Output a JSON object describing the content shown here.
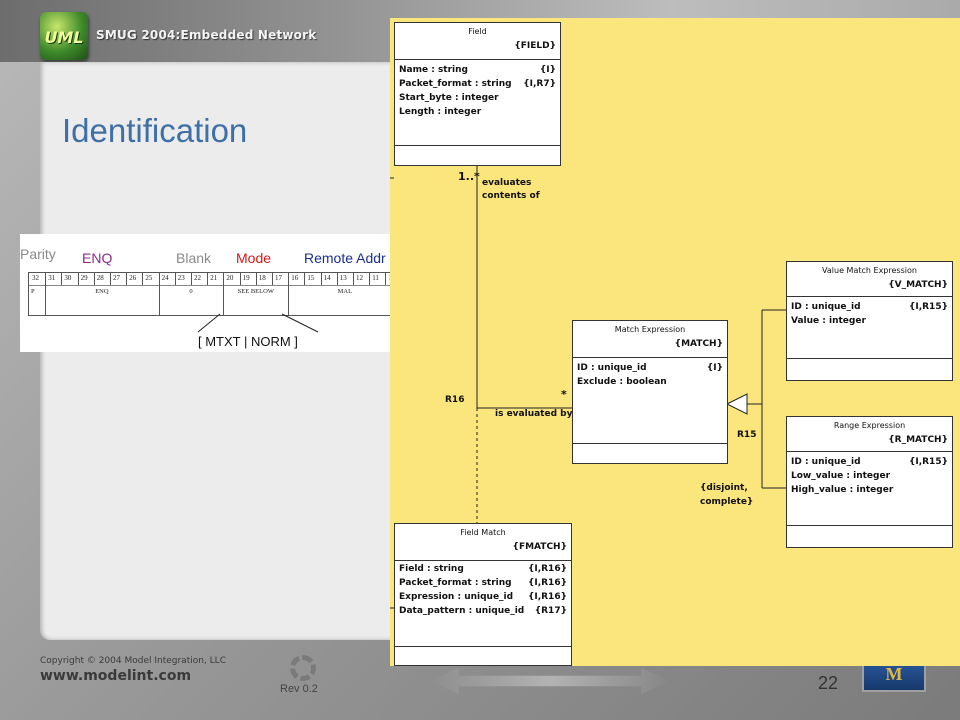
{
  "slide": {
    "banner_logo_text": "UML",
    "banner_title": "SMUG 2004:Embedded Network",
    "title": "Identification",
    "footer": {
      "copyright": "Copyright © 2004 Model Integration, LLC",
      "url": "www.modelint.com",
      "revision": "Rev 0.2",
      "page_number": "22",
      "logo_text": "M"
    }
  },
  "format": {
    "labels": [
      {
        "text": "Parity",
        "color": "#8a8a8a"
      },
      {
        "text": "ENQ",
        "color": "#8e2a8e"
      },
      {
        "text": "Blank",
        "color": "#8a8a8a"
      },
      {
        "text": "Mode",
        "color": "#d41515"
      },
      {
        "text": "Remote Addr",
        "color": "#1a2f8c"
      }
    ],
    "bit_numbers": [
      "32",
      "31",
      "30",
      "29",
      "28",
      "27",
      "26",
      "25",
      "24",
      "23",
      "22",
      "21",
      "20",
      "19",
      "18",
      "17",
      "16",
      "15",
      "14",
      "13",
      "12",
      "11",
      "10"
    ],
    "fields": [
      "P",
      "ENQ",
      "0",
      "SEE BELOW",
      "MAL"
    ],
    "mode_subtext": "[ MTXT | NORM ]"
  },
  "diagram": {
    "background": "#fbe57d",
    "classes": {
      "field": {
        "name": "Field",
        "key": "{FIELD}",
        "attributes": [
          {
            "name": "Name : string",
            "tag": "{I}"
          },
          {
            "name": "Packet_format : string",
            "tag": "{I,R7}"
          },
          {
            "name": "Start_byte : integer",
            "tag": ""
          },
          {
            "name": "Length : integer",
            "tag": ""
          }
        ]
      },
      "match_expression": {
        "name": "Match Expression",
        "key": "{MATCH}",
        "attributes": [
          {
            "name": "ID : unique_id",
            "tag": "{I}"
          },
          {
            "name": "Exclude : boolean",
            "tag": ""
          }
        ]
      },
      "value_match_expression": {
        "name": "Value Match Expression",
        "key": "{V_MATCH}",
        "attributes": [
          {
            "name": "ID : unique_id",
            "tag": "{I,R15}"
          },
          {
            "name": "Value : integer",
            "tag": ""
          }
        ]
      },
      "range_expression": {
        "name": "Range Expression",
        "key": "{R_MATCH}",
        "attributes": [
          {
            "name": "ID : unique_id",
            "tag": "{I,R15}"
          },
          {
            "name": "Low_value : integer",
            "tag": ""
          },
          {
            "name": "High_value : integer",
            "tag": ""
          }
        ]
      },
      "field_match": {
        "name": "Field Match",
        "key": "{FMATCH}",
        "attributes": [
          {
            "name": "Field : string",
            "tag": "{I,R16}"
          },
          {
            "name": "Packet_format : string",
            "tag": "{I,R16}"
          },
          {
            "name": "Expression : unique_id",
            "tag": "{I,R16}"
          },
          {
            "name": "Data_pattern : unique_id",
            "tag": "{R17}"
          }
        ]
      }
    },
    "labels": {
      "mult_field": "1..*",
      "phrase_field_1": "evaluates",
      "phrase_field_2": "contents of",
      "mult_match": "*",
      "phrase_match": "is evaluated by",
      "rel_r16": "R16",
      "rel_r15": "R15",
      "constraint_1": "{disjoint,",
      "constraint_2": "complete}"
    }
  }
}
